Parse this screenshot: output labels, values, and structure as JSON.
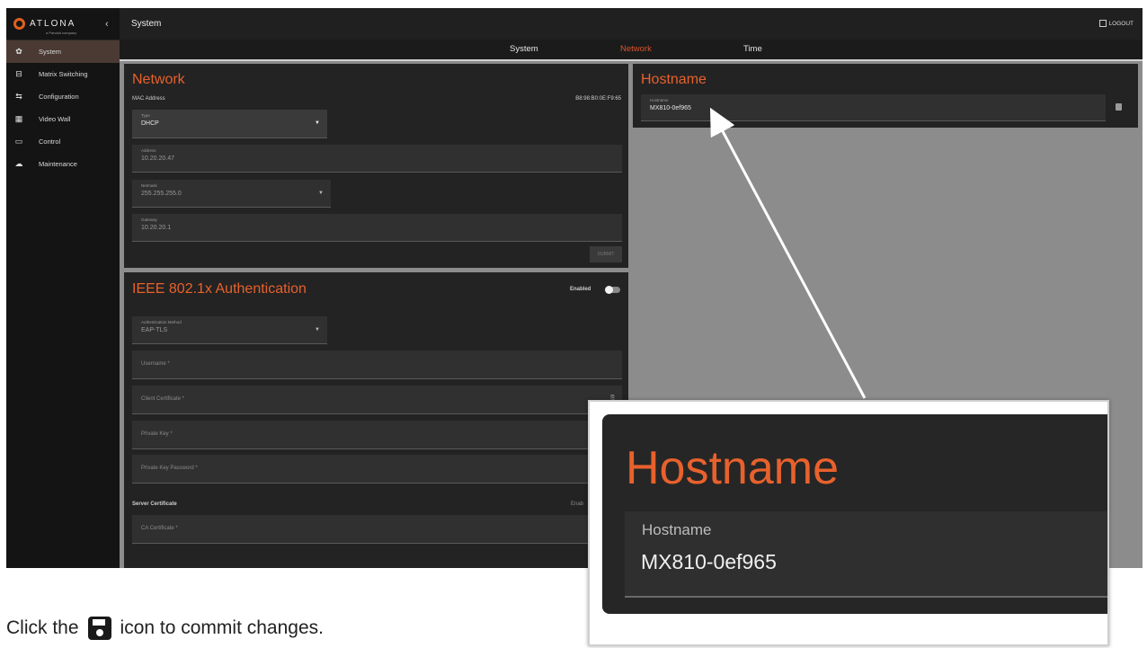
{
  "brand": {
    "name": "ATLONA",
    "sub": "a Panduit company"
  },
  "sidebar": {
    "collapse_glyph": "‹",
    "items": [
      {
        "label": "System",
        "icon": "gear-icon",
        "active": true
      },
      {
        "label": "Matrix Switching",
        "icon": "matrix-icon"
      },
      {
        "label": "Configuration",
        "icon": "config-icon"
      },
      {
        "label": "Video Wall",
        "icon": "grid-icon"
      },
      {
        "label": "Control",
        "icon": "monitor-icon"
      },
      {
        "label": "Maintenance",
        "icon": "cloud-icon"
      }
    ]
  },
  "topbar": {
    "title": "System",
    "logout": "LOGOUT"
  },
  "tabs": [
    {
      "label": "System"
    },
    {
      "label": "Network",
      "active": true
    },
    {
      "label": "Time"
    }
  ],
  "network": {
    "title": "Network",
    "mac_label": "MAC Address",
    "mac_value": "B8:98:B0:0E:F9:65",
    "type_label": "Type",
    "type_value": "DHCP",
    "address_label": "Address",
    "address_value": "10.20.20.47",
    "netmask_label": "Netmask",
    "netmask_value": "255.255.255.0",
    "gateway_label": "Gateway",
    "gateway_value": "10.20.20.1",
    "submit": "SUBMIT"
  },
  "ieee": {
    "title": "IEEE 802.1x Authentication",
    "enabled_label": "Enabled",
    "enabled": false,
    "auth_label": "Authentication Method",
    "auth_value": "EAP-TLS",
    "username_ph": "Username *",
    "client_cert_ph": "Client Certificate *",
    "private_key_ph": "Private Key *",
    "private_key_pw_ph": "Private Key Password *",
    "server_cert_label": "Server Certificate",
    "server_enabled_label": "Enab",
    "ca_cert_ph": "CA Certificate *"
  },
  "hostname": {
    "title": "Hostname",
    "label": "Hostname",
    "value": "MX810-0ef965"
  },
  "zoom": {
    "title": "Hostname",
    "label": "Hostname",
    "value": "MX810-0ef965"
  },
  "caption": {
    "before": "Click the",
    "after": "icon to commit changes."
  },
  "colors": {
    "accent": "#e8612c",
    "panel": "#232323",
    "backdrop": "#8c8c8c"
  }
}
